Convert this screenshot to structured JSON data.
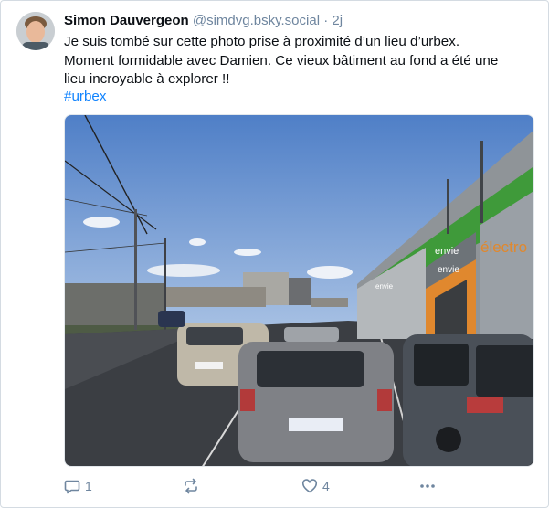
{
  "post": {
    "display_name": "Simon Dauvergeon",
    "handle": "@simdvg.bsky.social",
    "separator": "·",
    "age": "2j",
    "text_lines": [
      "Je suis tombé sur cette photo prise à proximité d’un lieu d’urbex.",
      "Moment formidable avec Damien. Ce vieux bâtiment au fond a été une",
      "lieu incroyable à explorer !!"
    ],
    "hashtag": "#urbex"
  },
  "photo": {
    "signs": [
      "envie",
      "envie",
      "envie",
      "électro"
    ]
  },
  "actions": {
    "reply_count": "1",
    "repost_count": "",
    "like_count": "4"
  },
  "colors": {
    "accent": "#1083fe",
    "muted": "#6f869f",
    "store_green": "#3f9a3a",
    "store_orange": "#e0882e"
  }
}
